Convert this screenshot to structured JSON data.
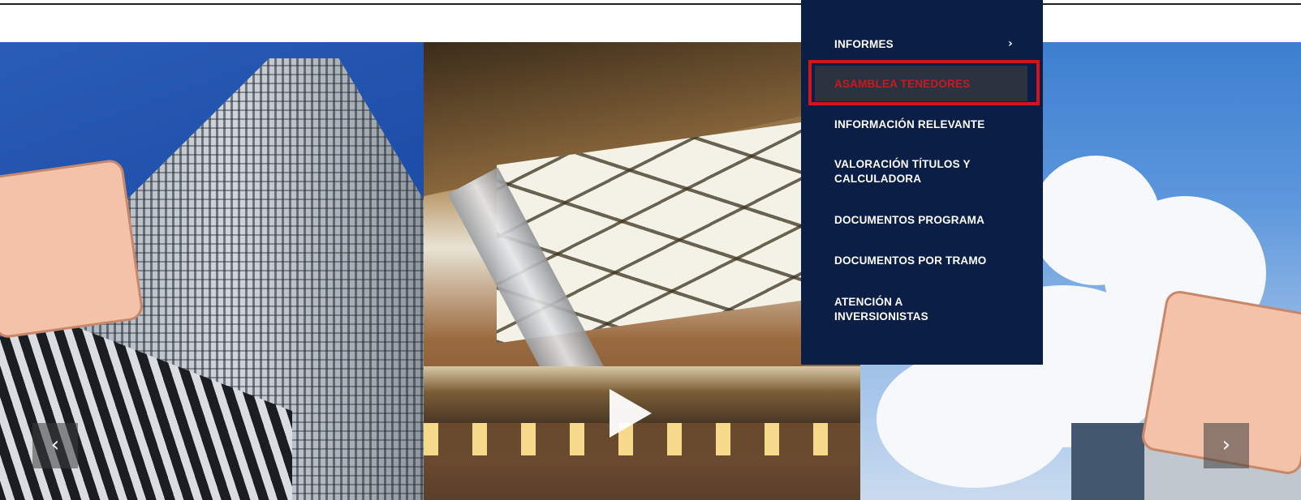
{
  "carousel": {
    "prev_label": "‹",
    "next_label": "›",
    "play_icon": "play-icon"
  },
  "menu": {
    "items": [
      {
        "label": "INFORMES",
        "has_submenu": true
      },
      {
        "label": "ASAMBLEA TENEDORES",
        "active": true
      },
      {
        "label": "INFORMACIÓN RELEVANTE"
      },
      {
        "label": "VALORACIÓN TÍTULOS Y CALCULADORA"
      },
      {
        "label": "DOCUMENTOS PROGRAMA"
      },
      {
        "label": "DOCUMENTOS POR TRAMO"
      },
      {
        "label": "ATENCIÓN A INVERSIONISTAS"
      }
    ],
    "submenu_indicator": "›"
  },
  "colors": {
    "menu_background": "#0b1e45",
    "highlight_border": "#d4141b",
    "active_text": "#c8191d"
  }
}
